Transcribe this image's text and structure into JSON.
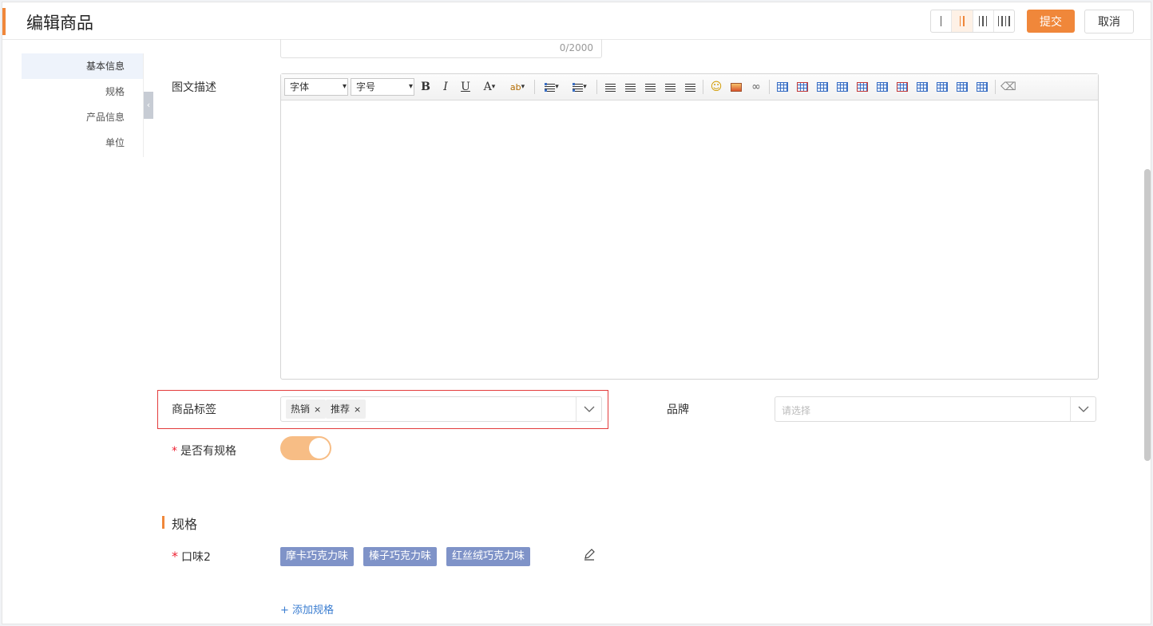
{
  "header": {
    "title": "编辑商品",
    "submit_label": "提交",
    "cancel_label": "取消",
    "column_options": [
      "1 column",
      "2 columns",
      "3 columns",
      "4 columns"
    ],
    "column_selected": "2 columns"
  },
  "sidenav": {
    "items": [
      {
        "label": "基本信息",
        "active": true
      },
      {
        "label": "规格",
        "active": false
      },
      {
        "label": "产品信息",
        "active": false
      },
      {
        "label": "单位",
        "active": false
      }
    ]
  },
  "form": {
    "counter": "0/2000",
    "rich_desc_label": "图文描述",
    "editor": {
      "font_label": "字体",
      "size_label": "字号"
    },
    "tags_label": "商品标签",
    "tags": [
      "热销",
      "推荐"
    ],
    "tag_remove": "×",
    "brand_label": "品牌",
    "brand_placeholder": "请选择",
    "has_spec_label": "是否有规格",
    "has_spec_required": "*",
    "has_spec_value": true
  },
  "spec_section": {
    "title": "规格",
    "required": "*",
    "spec_name": "口味2",
    "spec_values": [
      "摩卡巧克力味",
      "榛子巧克力味",
      "红丝绒巧克力味"
    ],
    "add_label": "+ 添加规格"
  },
  "colors": {
    "accent": "#f0873a",
    "spec_tag": "#7f93c8",
    "link": "#3b7ed1",
    "error_outline": "#e33b3b"
  }
}
